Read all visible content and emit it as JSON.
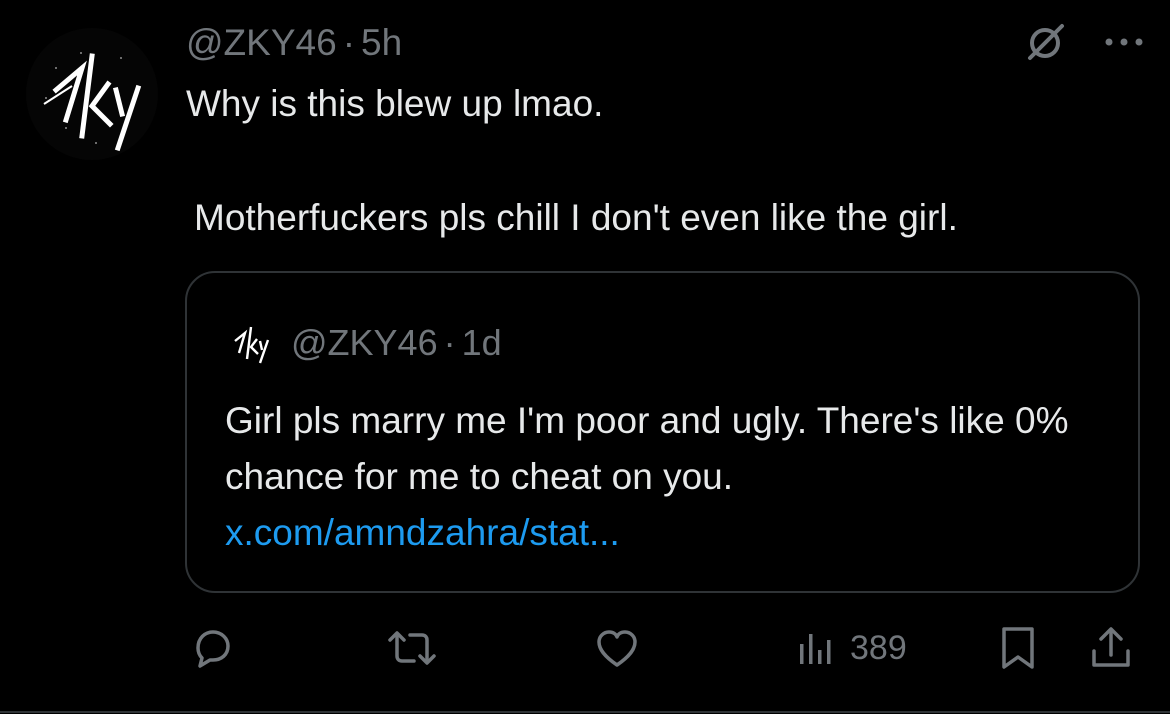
{
  "tweet": {
    "handle": "@ZKY46",
    "separator": "·",
    "time": "5h",
    "text_line1": "Why is this blew up lmao.",
    "text_line2": "Motherfuckers pls chill I don't even like the girl."
  },
  "avatar_logo_text": "ZKY",
  "quote": {
    "handle": "@ZKY46",
    "separator": "·",
    "time": "1d",
    "text": "Girl pls marry me I'm poor and ugly. There's like 0% chance for me to cheat on you.",
    "link": "x.com/amndzahra/stat..."
  },
  "actions": {
    "views": "389"
  },
  "icons": {
    "grok": "grok-icon",
    "more": "more-icon",
    "reply": "reply-icon",
    "retweet": "retweet-icon",
    "like": "heart-icon",
    "views": "views-icon",
    "bookmark": "bookmark-icon",
    "share": "share-icon"
  },
  "colors": {
    "background": "#000000",
    "text": "#e7e9ea",
    "secondary": "#71767b",
    "link": "#1d9bf0",
    "border": "#2f3336"
  }
}
